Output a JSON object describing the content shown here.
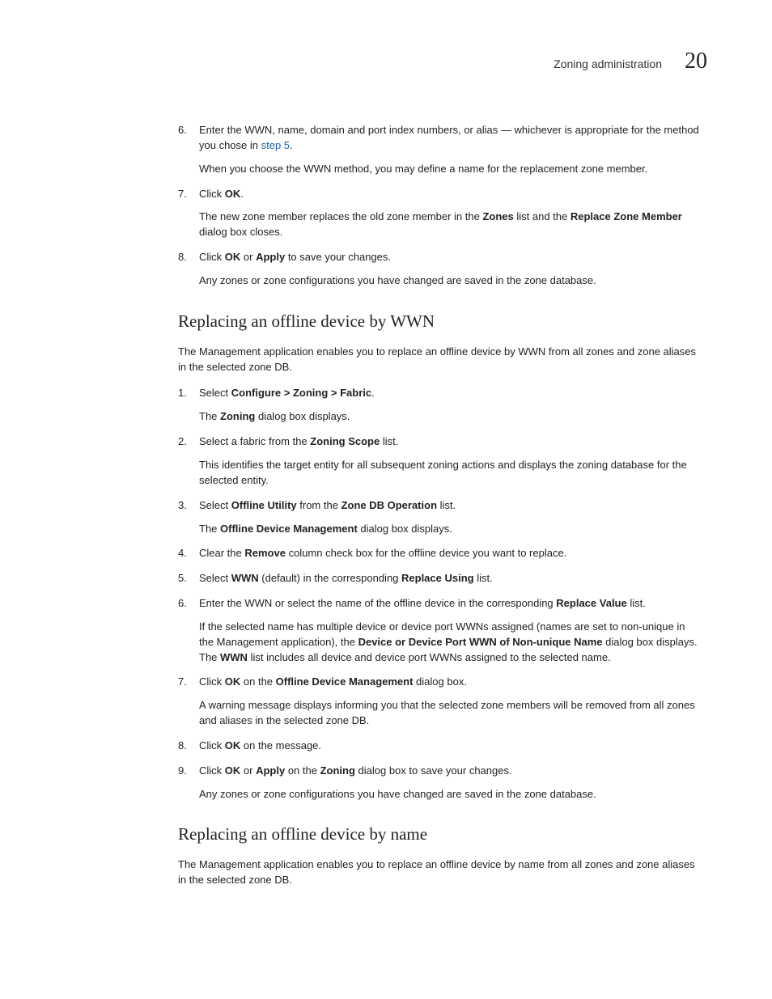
{
  "header": {
    "title": "Zoning administration",
    "chapter": "20"
  },
  "section1": {
    "steps": [
      {
        "num": "6.",
        "paras": [
          {
            "runs": [
              {
                "t": "Enter the WWN, name, domain and port index numbers, or alias — whichever is appropriate for the method you chose in "
              },
              {
                "t": "step 5",
                "cls": "link"
              },
              {
                "t": "."
              }
            ]
          },
          {
            "runs": [
              {
                "t": "When you choose the WWN method, you may define a name for the replacement zone member."
              }
            ]
          }
        ]
      },
      {
        "num": "7.",
        "paras": [
          {
            "runs": [
              {
                "t": "Click "
              },
              {
                "t": "OK",
                "cls": "bold"
              },
              {
                "t": "."
              }
            ]
          },
          {
            "runs": [
              {
                "t": "The new zone member replaces the old zone member in the "
              },
              {
                "t": "Zones",
                "cls": "bold"
              },
              {
                "t": " list and the "
              },
              {
                "t": "Replace Zone Member",
                "cls": "bold"
              },
              {
                "t": " dialog box closes."
              }
            ]
          }
        ]
      },
      {
        "num": "8.",
        "paras": [
          {
            "runs": [
              {
                "t": "Click "
              },
              {
                "t": "OK",
                "cls": "bold"
              },
              {
                "t": " or "
              },
              {
                "t": "Apply",
                "cls": "bold"
              },
              {
                "t": " to save your changes."
              }
            ]
          },
          {
            "runs": [
              {
                "t": "Any zones or zone configurations you have changed are saved in the zone database."
              }
            ]
          }
        ]
      }
    ]
  },
  "section2": {
    "heading": "Replacing an offline device by WWN",
    "intro": "The Management application enables you to replace an offline device by WWN from all zones and zone aliases in the selected zone DB.",
    "steps": [
      {
        "num": "1.",
        "paras": [
          {
            "runs": [
              {
                "t": "Select "
              },
              {
                "t": "Configure > Zoning > Fabric",
                "cls": "bold"
              },
              {
                "t": "."
              }
            ]
          },
          {
            "runs": [
              {
                "t": "The "
              },
              {
                "t": "Zoning",
                "cls": "bold"
              },
              {
                "t": " dialog box displays."
              }
            ]
          }
        ]
      },
      {
        "num": "2.",
        "paras": [
          {
            "runs": [
              {
                "t": "Select a fabric from the "
              },
              {
                "t": "Zoning Scope",
                "cls": "bold"
              },
              {
                "t": " list."
              }
            ]
          },
          {
            "runs": [
              {
                "t": "This identifies the target entity for all subsequent zoning actions and displays the zoning database for the selected entity."
              }
            ]
          }
        ]
      },
      {
        "num": "3.",
        "paras": [
          {
            "runs": [
              {
                "t": "Select "
              },
              {
                "t": "Offline Utility",
                "cls": "bold"
              },
              {
                "t": " from the "
              },
              {
                "t": "Zone DB Operation",
                "cls": "bold"
              },
              {
                "t": " list."
              }
            ]
          },
          {
            "runs": [
              {
                "t": "The "
              },
              {
                "t": "Offline Device Management",
                "cls": "bold"
              },
              {
                "t": " dialog box displays."
              }
            ]
          }
        ]
      },
      {
        "num": "4.",
        "paras": [
          {
            "runs": [
              {
                "t": "Clear the "
              },
              {
                "t": "Remove",
                "cls": "bold"
              },
              {
                "t": " column check box for the offline device you want to replace."
              }
            ]
          }
        ]
      },
      {
        "num": "5.",
        "paras": [
          {
            "runs": [
              {
                "t": "Select "
              },
              {
                "t": "WWN",
                "cls": "bold"
              },
              {
                "t": " (default) in the corresponding "
              },
              {
                "t": "Replace Using",
                "cls": "bold"
              },
              {
                "t": " list."
              }
            ]
          }
        ]
      },
      {
        "num": "6.",
        "paras": [
          {
            "runs": [
              {
                "t": "Enter the WWN or select the name of the offline device in the corresponding "
              },
              {
                "t": "Replace Value",
                "cls": "bold"
              },
              {
                "t": " list."
              }
            ]
          },
          {
            "runs": [
              {
                "t": "If the selected name has multiple device or device port WWNs assigned (names are set to non-unique in the Management application), the "
              },
              {
                "t": "Device or Device Port WWN of Non-unique Name",
                "cls": "bold"
              },
              {
                "t": " dialog box displays. The "
              },
              {
                "t": "WWN",
                "cls": "bold"
              },
              {
                "t": " list includes all device and device port WWNs assigned to the selected name."
              }
            ]
          }
        ]
      },
      {
        "num": "7.",
        "paras": [
          {
            "runs": [
              {
                "t": "Click "
              },
              {
                "t": "OK",
                "cls": "bold"
              },
              {
                "t": " on the "
              },
              {
                "t": "Offline Device Management",
                "cls": "bold"
              },
              {
                "t": " dialog box."
              }
            ]
          },
          {
            "runs": [
              {
                "t": "A warning message displays informing you that the selected zone members will be removed from all zones and aliases in the selected zone DB."
              }
            ]
          }
        ]
      },
      {
        "num": "8.",
        "paras": [
          {
            "runs": [
              {
                "t": "Click "
              },
              {
                "t": "OK",
                "cls": "bold"
              },
              {
                "t": " on the message."
              }
            ]
          }
        ]
      },
      {
        "num": "9.",
        "paras": [
          {
            "runs": [
              {
                "t": "Click "
              },
              {
                "t": "OK",
                "cls": "bold"
              },
              {
                "t": " or "
              },
              {
                "t": "Apply",
                "cls": "bold"
              },
              {
                "t": " on the "
              },
              {
                "t": "Zoning",
                "cls": "bold"
              },
              {
                "t": " dialog box to save your changes."
              }
            ]
          },
          {
            "runs": [
              {
                "t": "Any zones or zone configurations you have changed are saved in the zone database."
              }
            ]
          }
        ]
      }
    ]
  },
  "section3": {
    "heading": "Replacing an offline device by name",
    "intro": "The Management application enables you to replace an offline device by name from all zones and zone aliases in the selected zone DB."
  }
}
